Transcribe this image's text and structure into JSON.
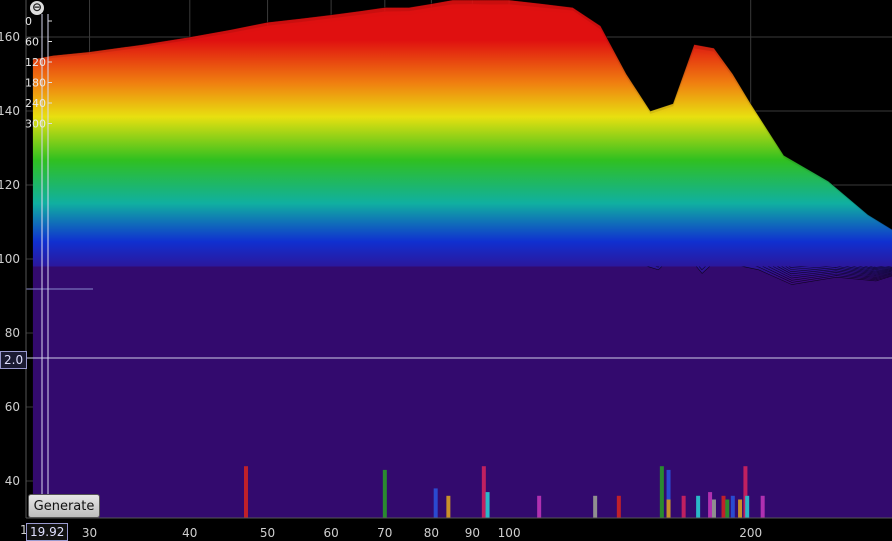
{
  "chart_data": {
    "type": "area",
    "subtype": "waterfall",
    "title": "",
    "xlabel": "",
    "ylabel": "",
    "x_scale": "log",
    "xlim": [
      25,
      300
    ],
    "ylim": [
      30,
      170
    ],
    "y_ticks": [
      160,
      140,
      120,
      100,
      80,
      60,
      40
    ],
    "x_ticks": [
      30,
      40,
      50,
      60,
      70,
      80,
      90,
      100,
      200
    ],
    "grid": true,
    "slice_values": [
      "0",
      "60",
      "120",
      "180",
      "240",
      "300"
    ],
    "front_series": {
      "x": [
        25.5,
        27,
        30,
        35,
        40,
        45,
        50,
        55,
        60,
        65,
        70,
        75,
        80,
        85,
        90,
        95,
        100,
        110,
        120,
        130,
        140,
        150,
        160,
        170,
        180,
        190,
        200,
        220,
        250,
        280,
        300
      ],
      "y": [
        154,
        155,
        156,
        158,
        160,
        162,
        164,
        165,
        166,
        167,
        168,
        168,
        169,
        170,
        170,
        170,
        170,
        169,
        168,
        163,
        150,
        140,
        142,
        158,
        157,
        150,
        142,
        128,
        121,
        112,
        108
      ]
    },
    "back_series": {
      "x": [
        25.5,
        27,
        30,
        35,
        40,
        45,
        50,
        55,
        60,
        65,
        70,
        75,
        80,
        85,
        90,
        95,
        100,
        110,
        120,
        130,
        140,
        150,
        160,
        170,
        180,
        190,
        200,
        220,
        250,
        280,
        300
      ],
      "y": [
        118,
        118,
        116,
        114,
        116,
        113,
        110,
        111,
        112,
        107,
        104,
        108,
        110,
        102,
        104,
        100,
        103,
        108,
        120,
        106,
        98,
        96,
        102,
        95,
        100,
        97,
        96,
        92,
        94,
        93,
        95
      ]
    },
    "floor_level": 98,
    "markers": [
      {
        "x": 47,
        "h": 44
      },
      {
        "x": 70,
        "h": 43
      },
      {
        "x": 81,
        "h": 38
      },
      {
        "x": 84,
        "h": 36
      },
      {
        "x": 93,
        "h": 44
      },
      {
        "x": 94,
        "h": 37
      },
      {
        "x": 109,
        "h": 36
      },
      {
        "x": 128,
        "h": 36
      },
      {
        "x": 137,
        "h": 36
      },
      {
        "x": 155,
        "h": 44
      },
      {
        "x": 158,
        "h": 43
      },
      {
        "x": 158,
        "h": 35
      },
      {
        "x": 165,
        "h": 36
      },
      {
        "x": 172,
        "h": 36
      },
      {
        "x": 178,
        "h": 37
      },
      {
        "x": 180,
        "h": 35
      },
      {
        "x": 185,
        "h": 36
      },
      {
        "x": 187,
        "h": 35
      },
      {
        "x": 190,
        "h": 36
      },
      {
        "x": 194,
        "h": 35
      },
      {
        "x": 197,
        "h": 44
      },
      {
        "x": 198,
        "h": 36
      },
      {
        "x": 207,
        "h": 36
      }
    ]
  },
  "colors": {
    "background": "#000000",
    "floor": "#330a6e",
    "grid": "#3a3a3a",
    "marker_colors": [
      "#c0202a",
      "#2a8a30",
      "#2a4ad0",
      "#c8902a",
      "#c02060",
      "#2ab8c8",
      "#b030b0",
      "#909090"
    ]
  },
  "ui": {
    "generate_label": "Generate",
    "current_value": "2.0",
    "cursor_x": "19.92",
    "x_axis_start": "1",
    "collapse_icon": "⊖"
  }
}
